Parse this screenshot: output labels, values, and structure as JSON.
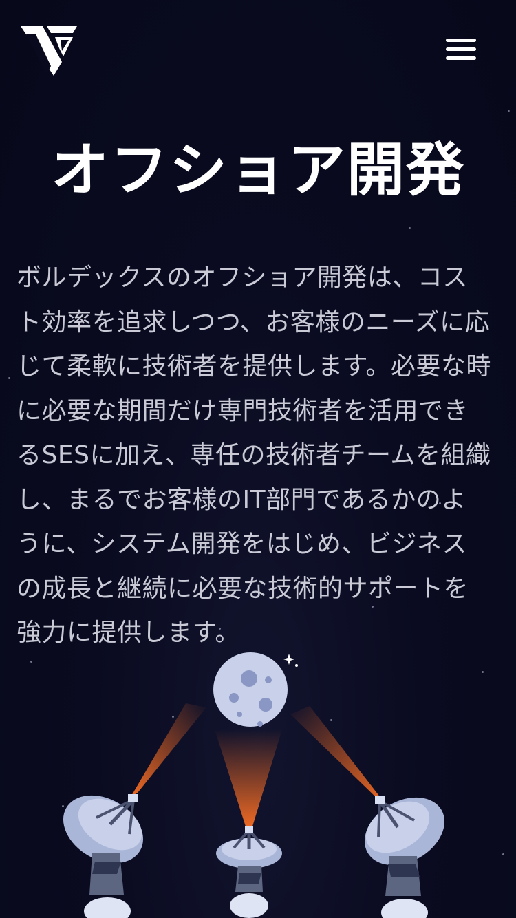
{
  "header": {
    "logo_name": "brand-logo",
    "menu_icon": "hamburger-menu-icon"
  },
  "hero": {
    "title": "オフショア開発",
    "description": "ボルデックスのオフショア開発は、コスト効率を追求しつつ、お客様のニーズに応じて柔軟に技術者を提供します。必要な時に必要な期間だけ専門技術者を活用できるSESに加え、専任の技術者チームを組織し、まるでお客様のIT部門であるかのように、システム開発をはじめ、ビジネスの成長と継続に必要な技術的サポートを強力に提供します。"
  },
  "illustration": {
    "subject": "moon-and-satellite-dishes",
    "beam_color": "#e8561c",
    "moon_color": "#c8d0ea",
    "dish_color": "#aab6d8"
  },
  "colors": {
    "background": "#090a1e",
    "title": "#ffffff",
    "body_text": "#c9cad6"
  }
}
